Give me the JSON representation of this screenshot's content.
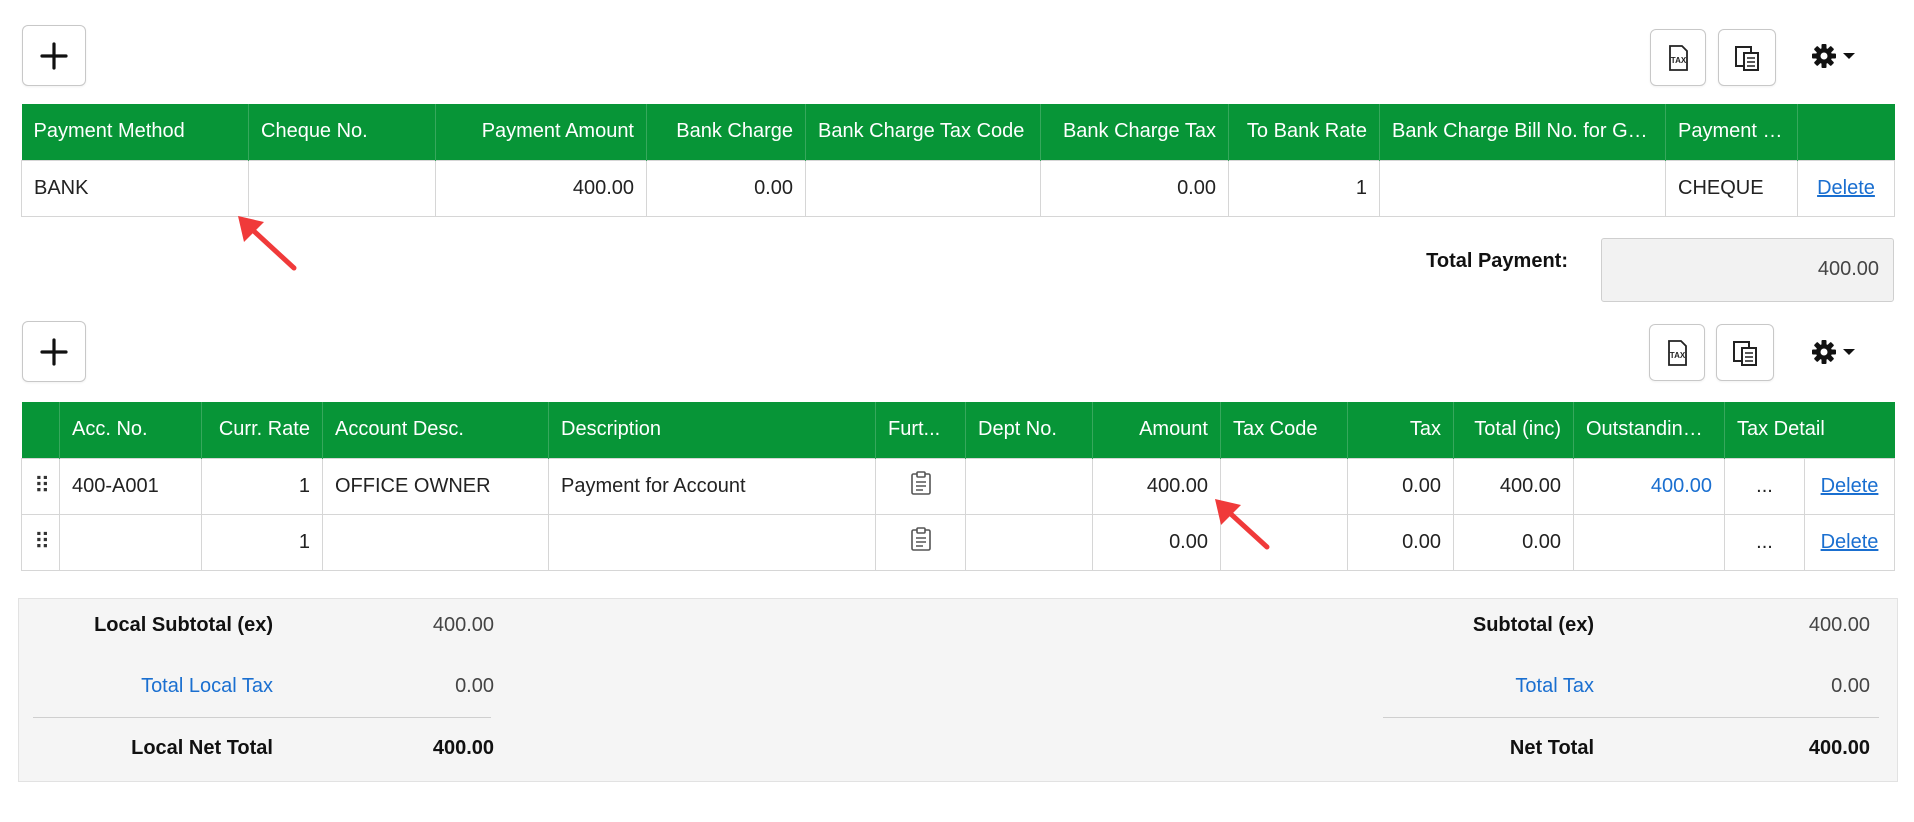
{
  "payment_toolbar": {
    "add_icon": "plus-icon",
    "tax_icon": "tax-icon",
    "copy_icon": "copy-layout-icon",
    "settings_icon": "gear-icon"
  },
  "payment_table": {
    "headers": [
      "Payment Method",
      "Cheque No.",
      "Payment Amount",
      "Bank Charge",
      "Bank Charge Tax Code",
      "Bank Charge Tax",
      "To Bank Rate",
      "Bank Charge Bill No. for GST",
      "Payment By",
      ""
    ],
    "rows": [
      {
        "payment_method": "BANK",
        "cheque_no": "",
        "payment_amount": "400.00",
        "bank_charge": "0.00",
        "bank_charge_tax_code": "",
        "bank_charge_tax": "0.00",
        "to_bank_rate": "1",
        "bill_no": "",
        "payment_by": "CHEQUE",
        "action": "Delete"
      }
    ]
  },
  "total_payment": {
    "label": "Total Payment:",
    "value": "400.00"
  },
  "detail_table": {
    "headers": [
      "",
      "Acc. No.",
      "Curr. Rate",
      "Account Desc.",
      "Description",
      "Furt...",
      "Dept No.",
      "Amount",
      "Tax Code",
      "Tax",
      "Total (inc)",
      "Outstanding ...",
      "Tax Detail"
    ],
    "rows": [
      {
        "acc_no": "400-A001",
        "curr_rate": "1",
        "account_desc": "OFFICE OWNER",
        "description": "Payment for Account",
        "dept_no": "",
        "amount": "400.00",
        "tax_code": "",
        "tax": "0.00",
        "total_inc": "400.00",
        "outstanding": "400.00",
        "tax_detail": "...",
        "action": "Delete"
      },
      {
        "acc_no": "",
        "curr_rate": "1",
        "account_desc": "",
        "description": "",
        "dept_no": "",
        "amount": "0.00",
        "tax_code": "",
        "tax": "0.00",
        "total_inc": "0.00",
        "outstanding": "",
        "tax_detail": "...",
        "action": "Delete"
      }
    ]
  },
  "totals": {
    "local_subtotal_label": "Local Subtotal (ex)",
    "local_subtotal_value": "400.00",
    "total_local_tax_label": "Total Local Tax",
    "total_local_tax_value": "0.00",
    "local_net_total_label": "Local Net Total",
    "local_net_total_value": "400.00",
    "subtotal_label": "Subtotal (ex)",
    "subtotal_value": "400.00",
    "total_tax_label": "Total Tax",
    "total_tax_value": "0.00",
    "net_total_label": "Net Total",
    "net_total_value": "400.00"
  },
  "colors": {
    "header_green": "#079537",
    "link_blue": "#1a6fd0",
    "annotation_red": "#f03a3a"
  }
}
